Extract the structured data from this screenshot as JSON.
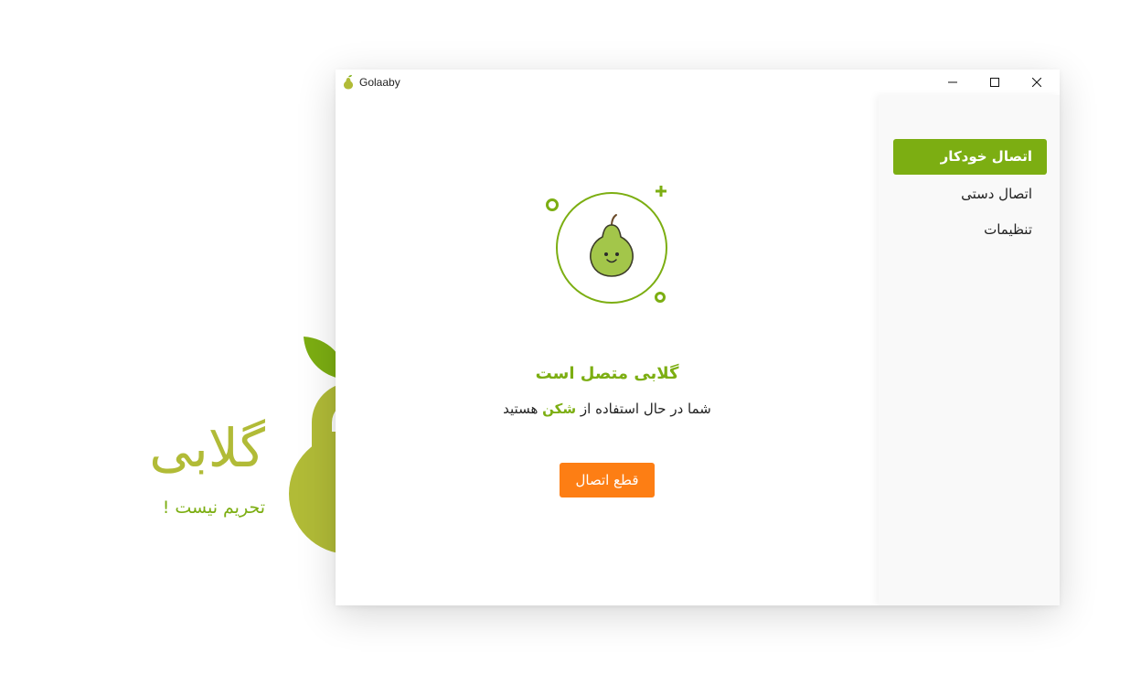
{
  "colors": {
    "brand_green": "#7cae12",
    "brand_olive": "#b1bb37",
    "accent_orange": "#fd7e14",
    "text": "#222222"
  },
  "branding": {
    "logo_icon": "pear-padlock-icon",
    "name": "گلابی",
    "tagline": "تحریم نیست !"
  },
  "window": {
    "title": "Golaaby",
    "app_icon": "pear-icon",
    "controls": {
      "minimize_icon": "minimize-icon",
      "maximize_icon": "maximize-icon",
      "close_icon": "close-icon"
    }
  },
  "sidebar": {
    "items": [
      {
        "label": "اتصال خودکار",
        "active": true
      },
      {
        "label": "اتصال دستی",
        "active": false
      },
      {
        "label": "تنظیمات",
        "active": false
      }
    ]
  },
  "main": {
    "illustration_icon": "pear-face-icon",
    "status_title": "گلابی متصل است",
    "subtitle_prefix": "شما در حال استفاده از",
    "subtitle_highlight": "شکن",
    "subtitle_suffix": "هستید",
    "disconnect_label": "قطع اتصال"
  }
}
